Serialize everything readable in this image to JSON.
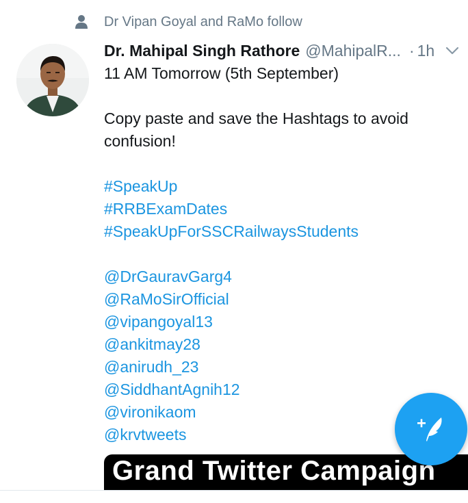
{
  "social_context": {
    "text": "Dr Vipan Goyal and RaMo follow",
    "icon": "person-icon"
  },
  "tweet": {
    "display_name": "Dr. Mahipal Singh Rathore",
    "handle": "@MahipalR...",
    "separator": "·",
    "timestamp": "1h",
    "lines": {
      "l1": "11 AM Tomorrow (5th September)",
      "l2": "Copy paste and save the Hashtags to avoid",
      "l3": "confusion!"
    },
    "hashtags": [
      "#SpeakUp",
      "#RRBExamDates",
      "#SpeakUpForSSCRailwaysStudents"
    ],
    "mentions": [
      "@DrGauravGarg4",
      "@RaMoSirOfficial",
      "@vipangoyal13",
      "@ankitmay28",
      "@anirudh_23",
      "@SiddhantAgnih12",
      "@vironikaom",
      "@krvtweets"
    ],
    "media_text": "Grand Twitter Campaign"
  },
  "colors": {
    "link": "#1b95e0",
    "fab": "#1da1f2",
    "muted": "#657786"
  },
  "fab_icon": "compose-tweet-icon"
}
